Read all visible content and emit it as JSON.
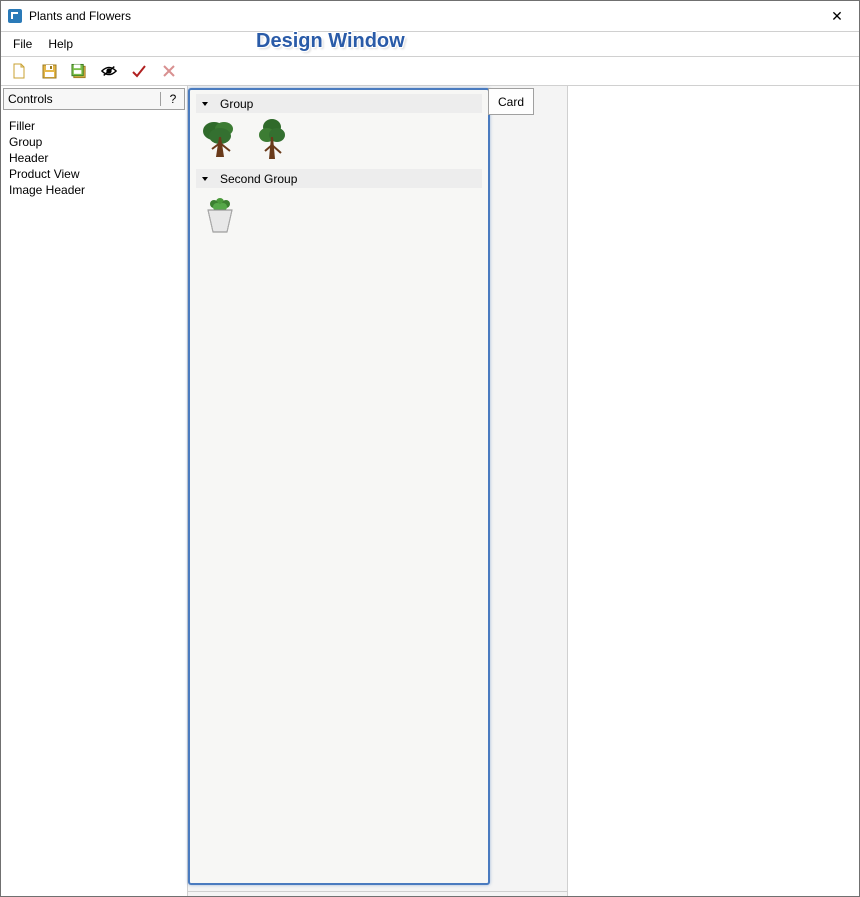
{
  "window": {
    "title": "Plants and Flowers"
  },
  "menu": {
    "file": "File",
    "help": "Help"
  },
  "annotation": "Design Window",
  "controls": {
    "header": "Controls",
    "help_glyph": "?",
    "items": [
      "Filler",
      "Group",
      "Header",
      "Product View",
      "Image Header"
    ]
  },
  "design": {
    "groups": [
      {
        "name": "Group"
      },
      {
        "name": "Second Group"
      }
    ]
  },
  "card_button": "Card",
  "close_glyph": "✕"
}
